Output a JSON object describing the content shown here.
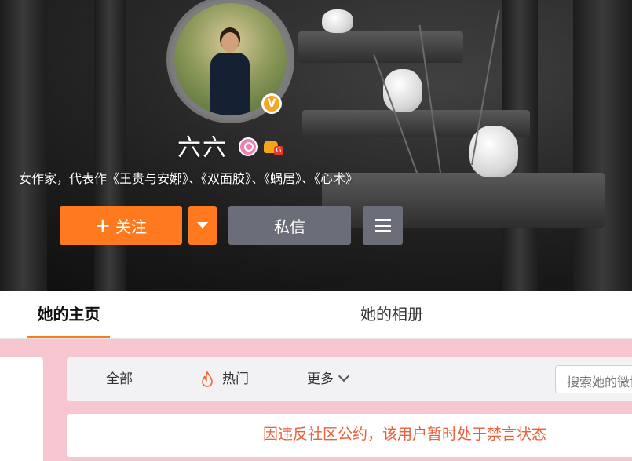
{
  "profile": {
    "name": "六六",
    "verified_badge": "V",
    "member_badge": "G",
    "bio": "女作家，代表作《王贵与安娜》、《双面胶》、《蜗居》、《心术》"
  },
  "actions": {
    "follow_plus": "+",
    "follow_label": "关注",
    "message_label": "私信"
  },
  "tabs": [
    {
      "label": "她的主页",
      "active": true
    },
    {
      "label": "她的相册",
      "active": false
    }
  ],
  "filter": {
    "all_label": "全部",
    "hot_label": "热门",
    "more_label": "更多",
    "search_placeholder": "搜索她的微博"
  },
  "notice": {
    "text": "因违反社区公约，该用户暂时处于禁言状态"
  },
  "colors": {
    "accent": "#ff7a1f",
    "secondary_button": "#6b6e78",
    "page_background": "#f7c6d1",
    "notice_text": "#e8603c"
  }
}
